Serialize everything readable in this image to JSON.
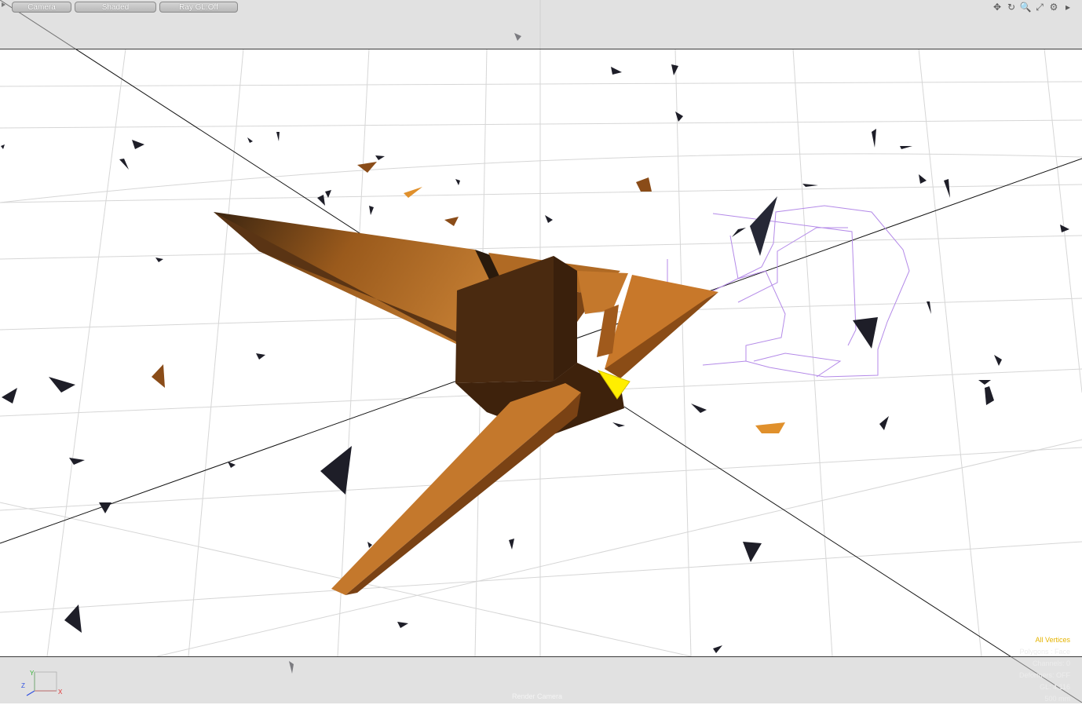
{
  "toolbar": {
    "camera_label": "Camera",
    "shading_label": "Shaded",
    "raygl_label": "Ray GL:Off",
    "tools": [
      {
        "icon": "move-view-icon",
        "glyph": "✥"
      },
      {
        "icon": "rotate-view-icon",
        "glyph": "↻"
      },
      {
        "icon": "zoom-view-icon",
        "glyph": "🔍"
      },
      {
        "icon": "fit-view-icon",
        "glyph": "⤢"
      },
      {
        "icon": "viewport-settings-icon",
        "glyph": "⚙"
      },
      {
        "icon": "viewport-menu-icon",
        "glyph": "▸"
      }
    ]
  },
  "status": {
    "selection_mode": "All Vertices",
    "polygons": "Polygons : Face",
    "channels": "Channels: 0",
    "deformers": "Deformers: OFF",
    "gl": "GL: 4,116",
    "grid": "500 mm"
  },
  "camera": {
    "label": "Render Camera"
  },
  "axes": {
    "x": "X",
    "y": "Y",
    "z": "Z"
  },
  "colors": {
    "mesh_light": "#c87a2c",
    "mesh_mid": "#9a5618",
    "mesh_dark": "#4a2a10",
    "debris_dark": "#1e1e28",
    "selection": "#ffee00",
    "wireframe": "#b080e8"
  }
}
